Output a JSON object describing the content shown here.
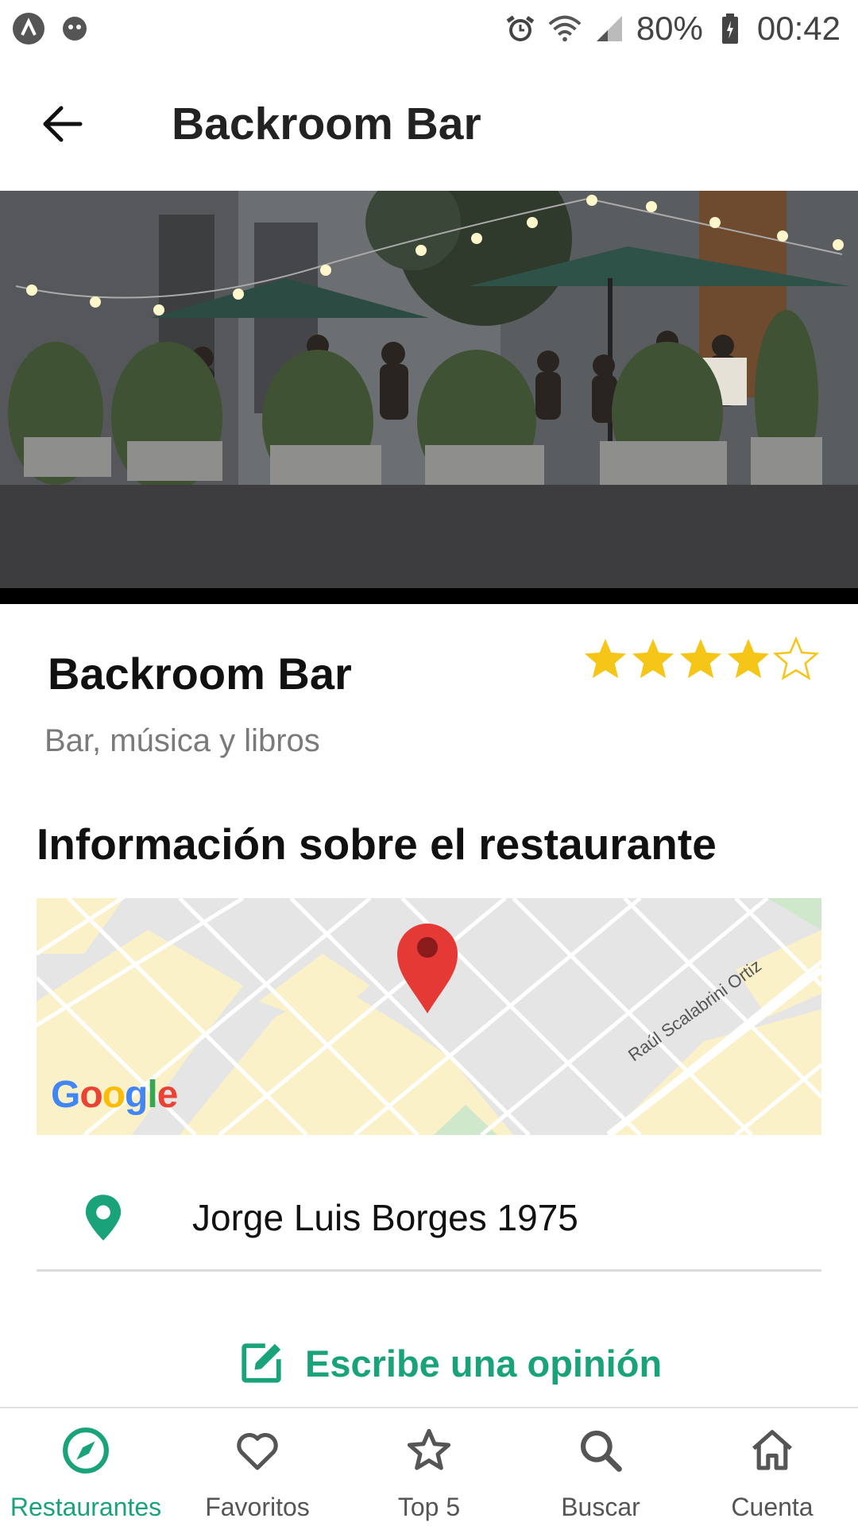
{
  "status_bar": {
    "battery": "80%",
    "time": "00:42",
    "icons": [
      "app-icon-a",
      "notification-icon",
      "alarm-icon",
      "wifi-icon",
      "signal-icon",
      "battery-icon"
    ]
  },
  "app_bar": {
    "title": "Backroom Bar",
    "back_icon": "arrow-left-icon"
  },
  "restaurant": {
    "name": "Backroom Bar",
    "description": "Bar, música y libros",
    "rating": 4,
    "rating_max": 5,
    "section_title": "Información sobre el restaurante",
    "address": "Jorge Luis Borges 1975"
  },
  "map": {
    "street_label": "Raúl Scalabrini Ortiz",
    "logo": "Google"
  },
  "review_button": {
    "label": "Escribe una opinión",
    "icon": "edit-icon"
  },
  "bottom_nav": [
    {
      "label": "Restaurantes",
      "icon": "compass-icon",
      "active": true
    },
    {
      "label": "Favoritos",
      "icon": "heart-icon",
      "active": false
    },
    {
      "label": "Top 5",
      "icon": "star-outline-icon",
      "active": false
    },
    {
      "label": "Buscar",
      "icon": "search-icon",
      "active": false
    },
    {
      "label": "Cuenta",
      "icon": "home-icon",
      "active": false
    }
  ],
  "colors": {
    "accent": "#1aa37a",
    "star": "#f5c518",
    "map_pin": "#e53935"
  }
}
